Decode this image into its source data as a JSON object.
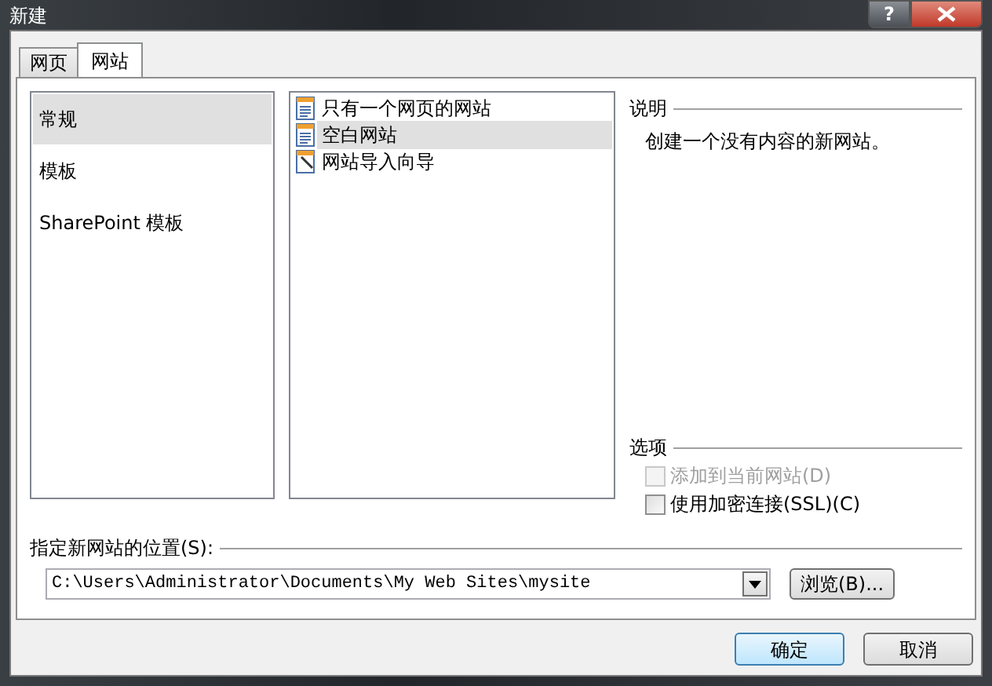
{
  "window": {
    "title": "新建",
    "help_button": "?"
  },
  "tabs": [
    {
      "label": "网页",
      "selected": false
    },
    {
      "label": "网站",
      "selected": true
    }
  ],
  "categories": [
    {
      "label": "常规",
      "selected": true
    },
    {
      "label": "模板",
      "selected": false
    },
    {
      "label": "SharePoint 模板",
      "selected": false
    }
  ],
  "templates": [
    {
      "label": "只有一个网页的网站",
      "kind": "page",
      "selected": false
    },
    {
      "label": "空白网站",
      "kind": "page",
      "selected": true
    },
    {
      "label": "网站导入向导",
      "kind": "wizard",
      "selected": false
    }
  ],
  "description": {
    "heading": "说明",
    "text": "创建一个没有内容的新网站。"
  },
  "options": {
    "heading": "选项",
    "items": [
      {
        "label": "添加到当前网站(D)",
        "checked": false,
        "disabled": true
      },
      {
        "label": "使用加密连接(SSL)(C)",
        "checked": false,
        "disabled": false
      }
    ]
  },
  "location": {
    "label": "指定新网站的位置(S):",
    "value": "C:\\Users\\Administrator\\Documents\\My Web Sites\\mysite",
    "browse_button": "浏览(B)..."
  },
  "buttons": [
    {
      "label": "确定",
      "default": true
    },
    {
      "label": "取消",
      "default": false
    }
  ]
}
